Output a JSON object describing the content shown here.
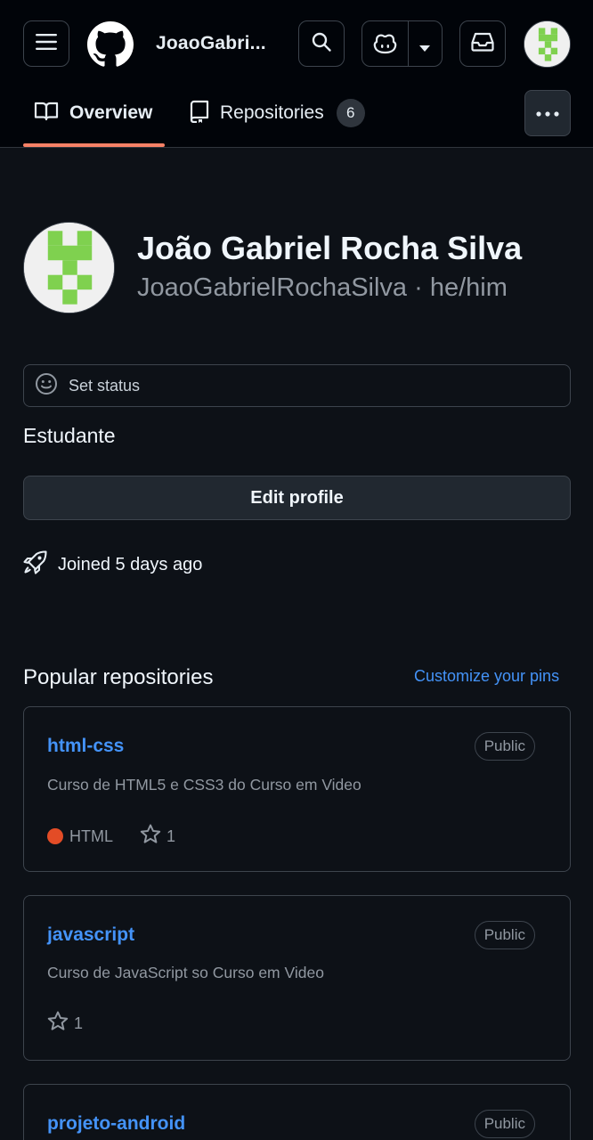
{
  "header": {
    "username": "JoaoGabri...",
    "icons": {
      "menu": "hamburger-icon",
      "logo": "github-logo-icon",
      "search": "search-icon",
      "copilot": "copilot-icon",
      "dropdown": "triangle-down-icon",
      "inbox": "inbox-icon"
    }
  },
  "tabs": {
    "overview_label": "Overview",
    "repositories_label": "Repositories",
    "repositories_count": "6"
  },
  "profile": {
    "full_name": "João Gabriel Rocha Silva",
    "login_line": "JoaoGabrielRochaSilva · he/him",
    "status_placeholder": "Set status",
    "bio": "Estudante",
    "edit_button": "Edit profile",
    "joined": "Joined 5 days ago"
  },
  "popular": {
    "title": "Popular repositories",
    "customize_link": "Customize your pins",
    "repos": [
      {
        "name": "html-css",
        "visibility": "Public",
        "description": "Curso de HTML5 e CSS3 do Curso em Video",
        "language": "HTML",
        "stars": "1"
      },
      {
        "name": "javascript",
        "visibility": "Public",
        "description": "Curso de JavaScript so Curso em Video",
        "stars": "1"
      },
      {
        "name": "projeto-android",
        "visibility": "Public"
      }
    ]
  },
  "colors": {
    "background": "#0d1117",
    "link": "#4493f8",
    "tab_underline": "#f78166",
    "html_language": "#e34c26",
    "avatar_green": "#7fd14f"
  }
}
